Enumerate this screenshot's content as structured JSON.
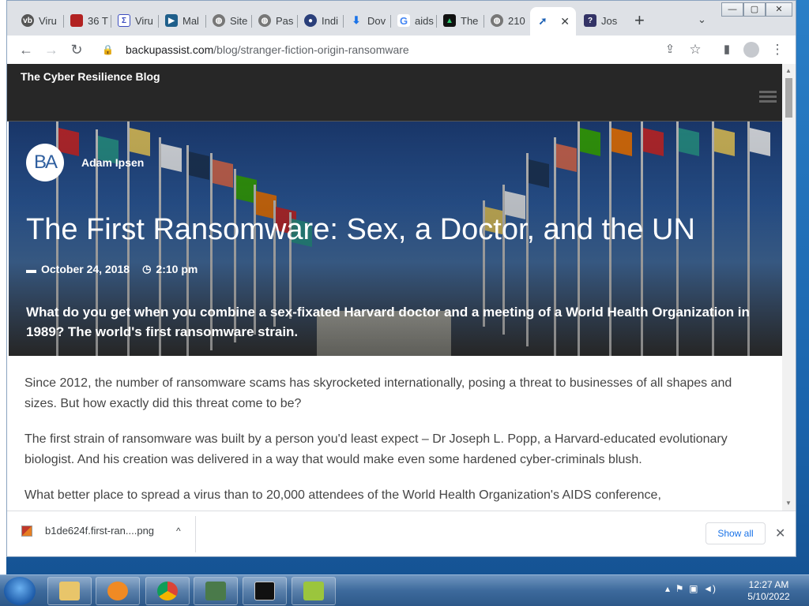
{
  "browser": {
    "tabs": [
      {
        "label": "Viru",
        "fav_color": "#555555",
        "fav_text": "vb"
      },
      {
        "label": "36 T",
        "fav_color": "#b22222",
        "fav_text": ""
      },
      {
        "label": "Viru",
        "fav_color": "#3b4cc0",
        "fav_text": "Σ"
      },
      {
        "label": "Mal",
        "fav_color": "#1f5f8b",
        "fav_text": "▶"
      },
      {
        "label": "Site",
        "fav_color": "#777777",
        "fav_text": "◍"
      },
      {
        "label": "Pas",
        "fav_color": "#777777",
        "fav_text": "◍"
      },
      {
        "label": "Indi",
        "fav_color": "#2a3f7a",
        "fav_text": "●"
      },
      {
        "label": "Dov",
        "fav_color": "#1a73e8",
        "fav_text": "⬇"
      },
      {
        "label": "aids",
        "fav_color": "#ffffff",
        "fav_text": "G"
      },
      {
        "label": "The",
        "fav_color": "#111111",
        "fav_text": "▲"
      },
      {
        "label": "210",
        "fav_color": "#777777",
        "fav_text": "◍"
      },
      {
        "label": "",
        "fav_color": "#1a5fb4",
        "fav_text": "➚",
        "active": true
      },
      {
        "label": "Jos",
        "fav_color": "#333366",
        "fav_text": "?"
      }
    ],
    "new_tab": "+",
    "tab_search": "⌄",
    "window_controls": {
      "minimize": "—",
      "maximize": "▢",
      "close": "✕"
    },
    "url_host": "backupassist.com",
    "url_path": "/blog/stranger-fiction-origin-ransomware"
  },
  "icons": {
    "back": "←",
    "forward": "→",
    "reload": "↻",
    "lock": "🔒",
    "share": "⇪",
    "star": "☆",
    "sidepanel": "▮",
    "menu": "⋮",
    "close": "✕",
    "calendar": "▬",
    "clock": "◷"
  },
  "site": {
    "title": "The Cyber Resilience Blog",
    "author_initials": "BA",
    "author_name": "Adam Ipsen",
    "post_title": "The First Ransomware: Sex, a Doctor, and the UN",
    "date": "October 24, 2018",
    "time": "2:10 pm",
    "lede": "What do you get when you combine a sex-fixated Harvard doctor and a meeting of a World Health Organization in 1989? The world's first ransomware strain.",
    "paragraphs": [
      "Since 2012, the number of ransomware scams has skyrocketed internationally, posing a threat to businesses of all shapes and sizes. But how exactly did this threat come to be?",
      "The first strain of ransomware was built by a person you'd least expect – Dr Joseph L. Popp, a Harvard-educated evolutionary biologist. And his creation was delivered in a way that would make even some hardened cyber-criminals blush.",
      "What better place to spread a virus than to 20,000 attendees of the World Health Organization's AIDS conference,"
    ]
  },
  "downloads": {
    "file_name": "b1de624f.first-ran....png",
    "chevron": "^",
    "show_all": "Show all"
  },
  "taskbar": {
    "clock_time": "12:27 AM",
    "clock_date": "5/10/2022"
  }
}
